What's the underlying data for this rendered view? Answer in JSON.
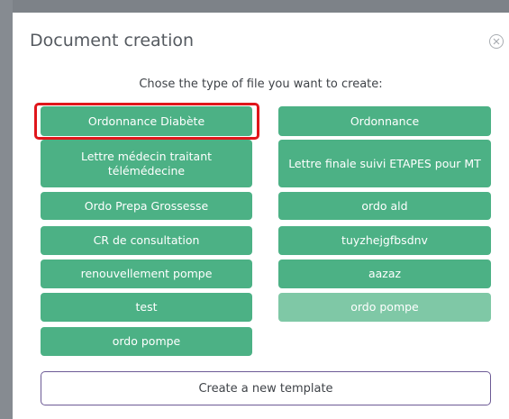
{
  "modal": {
    "title": "Document creation",
    "instructions": "Chose the type of file you want to create:",
    "close_icon": "close-circle-icon",
    "create_button_label": "Create a new template"
  },
  "templates_left": [
    {
      "label": "Ordonnance Diabète",
      "highlighted": true,
      "faded": false
    },
    {
      "label": "Lettre médecin traitant télémédecine",
      "highlighted": false,
      "faded": false
    },
    {
      "label": "Ordo Prepa Grossesse",
      "highlighted": false,
      "faded": false
    },
    {
      "label": "CR de consultation",
      "highlighted": false,
      "faded": false
    },
    {
      "label": "renouvellement pompe",
      "highlighted": false,
      "faded": false
    },
    {
      "label": "test",
      "highlighted": false,
      "faded": false
    },
    {
      "label": "ordo pompe",
      "highlighted": false,
      "faded": false
    }
  ],
  "templates_right": [
    {
      "label": "Ordonnance",
      "faded": false
    },
    {
      "label": "Lettre finale suivi ETAPES pour MT",
      "faded": false
    },
    {
      "label": "ordo ald",
      "faded": false
    },
    {
      "label": "tuyzhejgfbsdnv",
      "faded": false
    },
    {
      "label": "aazaz",
      "faded": false
    },
    {
      "label": "ordo pompe",
      "faded": true
    }
  ],
  "colors": {
    "button_green": "#4cb185",
    "button_green_faded": "#7fc8a6",
    "highlight_red": "#e0161b",
    "create_button_border": "#6c5a95",
    "overlay_gray": "#8b9096"
  }
}
